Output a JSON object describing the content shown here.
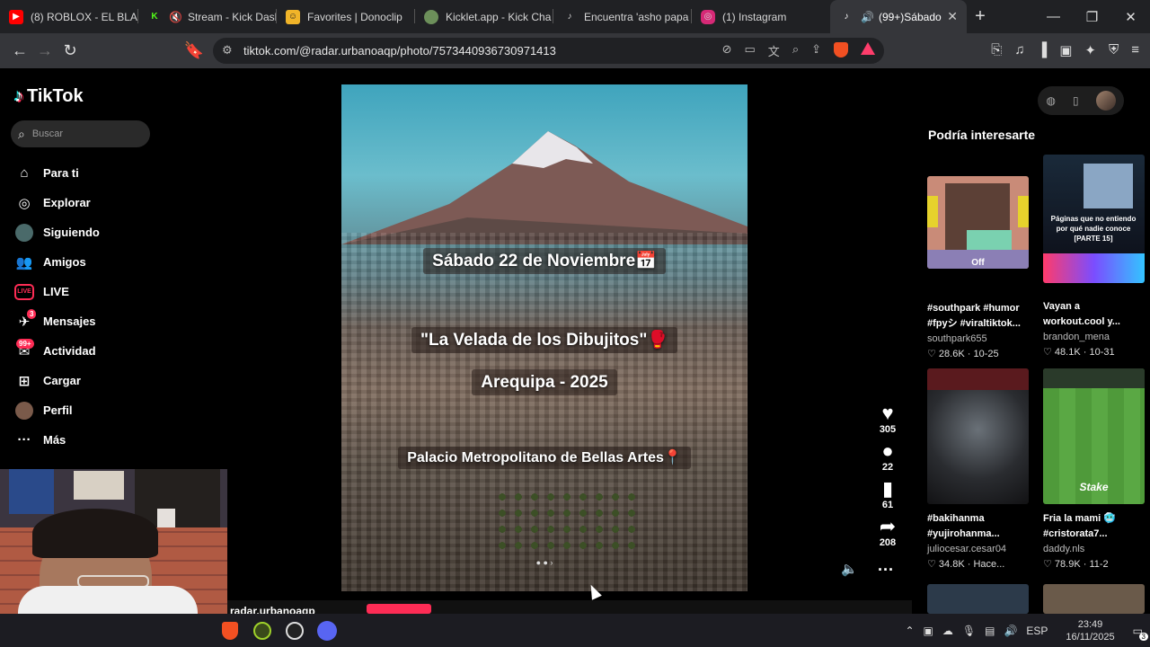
{
  "browser": {
    "tabs": [
      {
        "title": "(8) ROBLOX - EL BLAD",
        "icon": "youtube-icon",
        "color": "#ff0000"
      },
      {
        "title": "Stream - Kick Dasl",
        "icon": "kick-icon",
        "color": "#53fc18"
      },
      {
        "title": "Favorites | Donoclip",
        "icon": "donoclip-icon",
        "color": "#f0b429"
      },
      {
        "title": "Kicklet.app - Kick Cha",
        "icon": "kicklet-icon",
        "color": "#6c8f5a"
      },
      {
        "title": "Encuentra 'asho papa",
        "icon": "tiktok-icon",
        "color": "#000000"
      },
      {
        "title": "(1) Instagram",
        "icon": "instagram-icon",
        "color": "#d62976"
      },
      {
        "title": "(99+)Sábado",
        "icon": "tiktok-icon",
        "color": "#000000",
        "active": true
      }
    ],
    "url": "tiktok.com/@radar.urbanoaqp/photo/7573440936730971413",
    "brave_badge": "4"
  },
  "sidebar": {
    "logo": "TikTok",
    "search_placeholder": "Buscar",
    "items": [
      {
        "label": "Para ti",
        "icon": "home-icon"
      },
      {
        "label": "Explorar",
        "icon": "compass-icon"
      },
      {
        "label": "Siguiendo",
        "icon": "following-icon"
      },
      {
        "label": "Amigos",
        "icon": "friends-icon"
      },
      {
        "label": "LIVE",
        "icon": "live-icon"
      },
      {
        "label": "Mensajes",
        "icon": "messages-icon",
        "badge": "3"
      },
      {
        "label": "Actividad",
        "icon": "activity-icon",
        "badge": "99+"
      },
      {
        "label": "Cargar",
        "icon": "upload-icon"
      },
      {
        "label": "Perfil",
        "icon": "profile-icon"
      },
      {
        "label": "Más",
        "icon": "more-icon"
      }
    ]
  },
  "post": {
    "line1": "Sábado 22 de Noviembre📅",
    "line2": "\"La Velada de los Dibujitos\"🥊",
    "line3": "Arequipa - 2025",
    "line4": "Palacio Metropolitano de Bellas Artes📍",
    "author": "radar.urbanoaqp",
    "likes": "305",
    "comments": "22",
    "saves": "61",
    "shares": "208"
  },
  "suggestions": {
    "title": "Podría interesarte",
    "cards": [
      {
        "caption1": "#southpark #humor",
        "caption2": "#fpyシ #viraltiktok...",
        "author": "southpark655",
        "likes": "28.6K",
        "date": "10-25",
        "thumb_text": "Off"
      },
      {
        "caption1": "Vayan a",
        "caption2": "workout.cool y...",
        "author": "brandon_mena",
        "likes": "48.1K",
        "date": "10-31",
        "thumb_text": "Páginas que no entiendo por qué nadie conoce [PARTE 15]"
      },
      {
        "caption1": "#bakihanma",
        "caption2": "#yujirohanma...",
        "author": "juliocesar.cesar04",
        "likes": "34.8K",
        "date": "Hace...",
        "thumb_text": ""
      },
      {
        "caption1": "Fria la mami 🥶",
        "caption2": "#cristorata7...",
        "author": "daddy.nls",
        "likes": "78.9K",
        "date": "11-2",
        "thumb_text": "Stake"
      }
    ]
  },
  "taskbar": {
    "lang": "ESP",
    "time": "23:49",
    "date": "16/11/2025",
    "notif": "3"
  }
}
